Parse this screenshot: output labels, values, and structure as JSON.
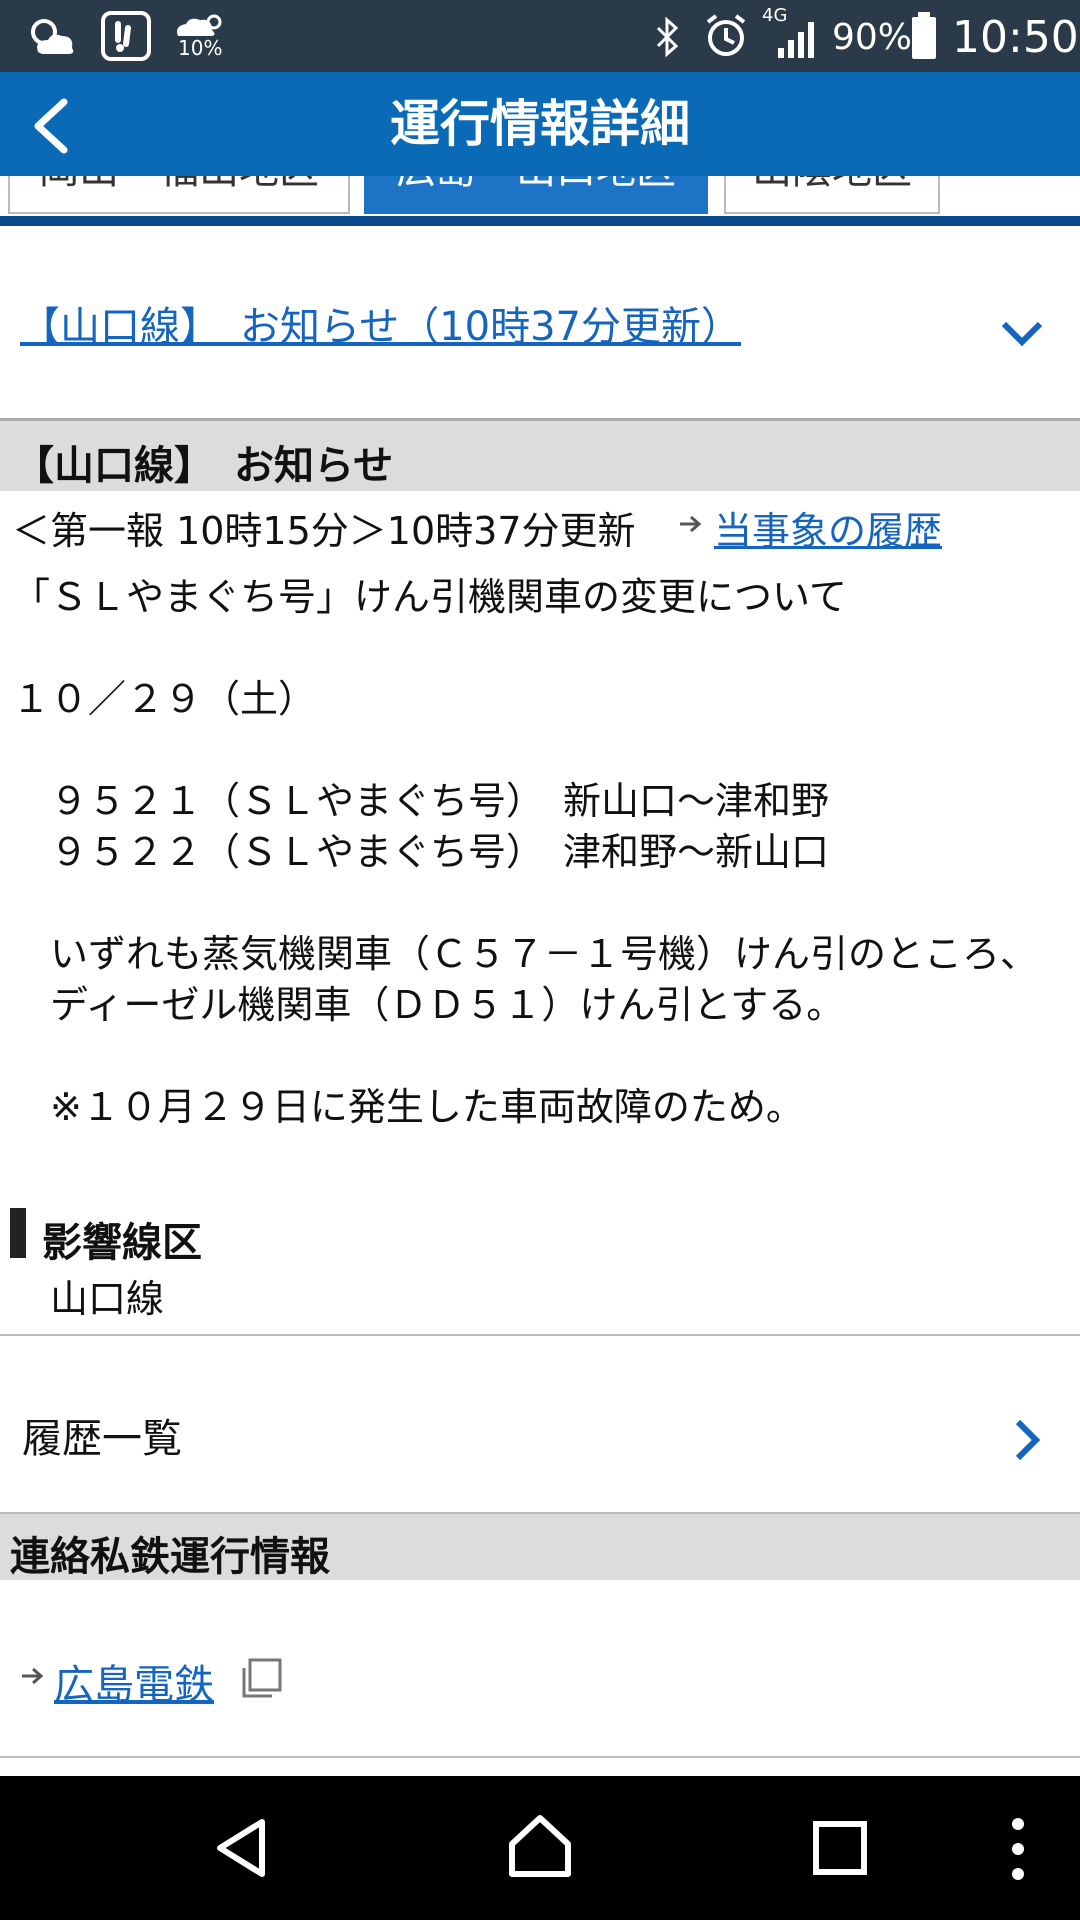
{
  "status_bar": {
    "left_icons": [
      "weather-cloud-icon",
      "app-icon",
      "weather-percent-icon"
    ],
    "rain_percent": "10%",
    "network": "4G",
    "battery": "90%",
    "time": "10:50"
  },
  "app_bar": {
    "title": "運行情報詳細"
  },
  "tabs": [
    {
      "label": "岡山・福山地区",
      "active": false
    },
    {
      "label": "広島・山口地区",
      "active": true
    },
    {
      "label": "山陰地区",
      "active": false
    }
  ],
  "notice_link": {
    "label": "【山口線】　お知らせ（10時37分更新）"
  },
  "notice": {
    "header": "【山口線】　お知らせ",
    "meta": "＜第一報  10時15分＞10時37分更新",
    "history_link": "当事象の履歴",
    "body": [
      "「ＳＬやまぐち号」けん引機関車の変更について",
      "",
      "１０／２９（土）",
      "",
      "　９５２１（ＳＬやまぐち号）　新山口～津和野",
      "　９５２２（ＳＬやまぐち号）　津和野～新山口",
      "",
      "　いずれも蒸気機関車（Ｃ５７－１号機）けん引のところ、",
      "　ディーゼル機関車（ＤＤ５１）けん引とする。",
      "",
      "　※１０月２９日に発生した車両故障のため。"
    ],
    "affected_title": "影響線区",
    "affected_value": "山口線"
  },
  "history_list": {
    "label": "履歴一覧"
  },
  "private_rail": {
    "header": "連絡私鉄運行情報",
    "link": "広島電鉄"
  }
}
